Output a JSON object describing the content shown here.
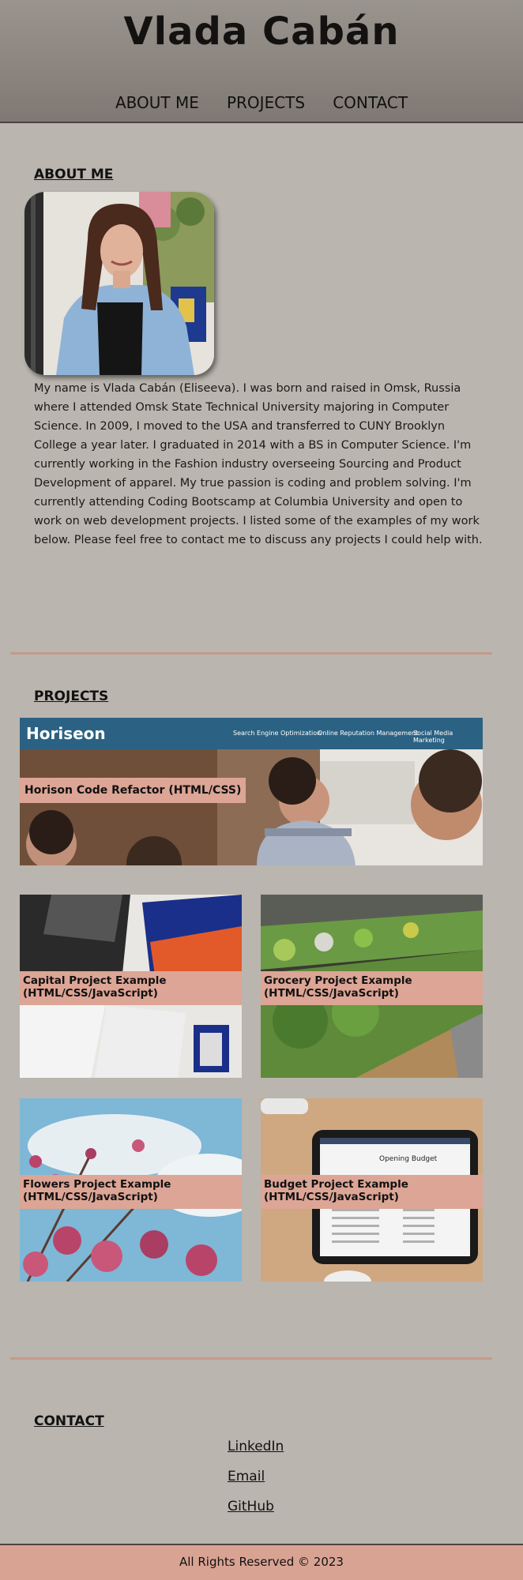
{
  "header": {
    "title": "Vlada Cabán",
    "nav": [
      "ABOUT ME",
      "PROJECTS",
      "CONTACT"
    ]
  },
  "about": {
    "heading": "ABOUT ME",
    "bio": "My name is Vlada Cabán (Eliseeva). I was born and raised in Omsk, Russia where I attended Omsk State Technical University majoring in Computer Science. In 2009, I moved to the USA and transferred to CUNY Brooklyn College a year later. I graduated in 2014 with a BS in Computer Science. I'm currently working in the Fashion industry overseeing Sourcing and Product Development of apparel. My true passion is coding and problem solving. I'm currently attending Coding Bootscamp at Columbia University and open to work on web development projects. I listed some of the examples of my work below. Please feel free to contact me to discuss any projects I could help with."
  },
  "projects": {
    "heading": "PROJECTS",
    "featured": {
      "label": "Horison Code Refactor (HTML/CSS)",
      "screenshot_brand": "Horiseon",
      "screenshot_nav": [
        "Search Engine Optimization",
        "Online Reputation Management",
        "Social Media Marketing"
      ]
    },
    "items": [
      {
        "label_line1": "Capital Project Example",
        "label_line2": "(HTML/CSS/JavaScript)"
      },
      {
        "label_line1": "Grocery Project Example",
        "label_line2": "(HTML/CSS/JavaScript)"
      },
      {
        "label_line1": "Flowers Project Example",
        "label_line2": "(HTML/CSS/JavaScript)"
      },
      {
        "label_line1": "Budget Project Example",
        "label_line2": "(HTML/CSS/JavaScript)"
      }
    ],
    "budget_screen_title": "Opening Budget"
  },
  "contact": {
    "heading": "CONTACT",
    "links": [
      "LinkedIn",
      "Email",
      "GitHub"
    ]
  },
  "footer": {
    "text": "All Rights Reserved © 2023"
  },
  "colors": {
    "page_bg": "#bab5ae",
    "header_bg": "#8a837e",
    "label_bg": "#dca595",
    "divider": "#c49a8b",
    "footer_bg": "#d9a394"
  }
}
